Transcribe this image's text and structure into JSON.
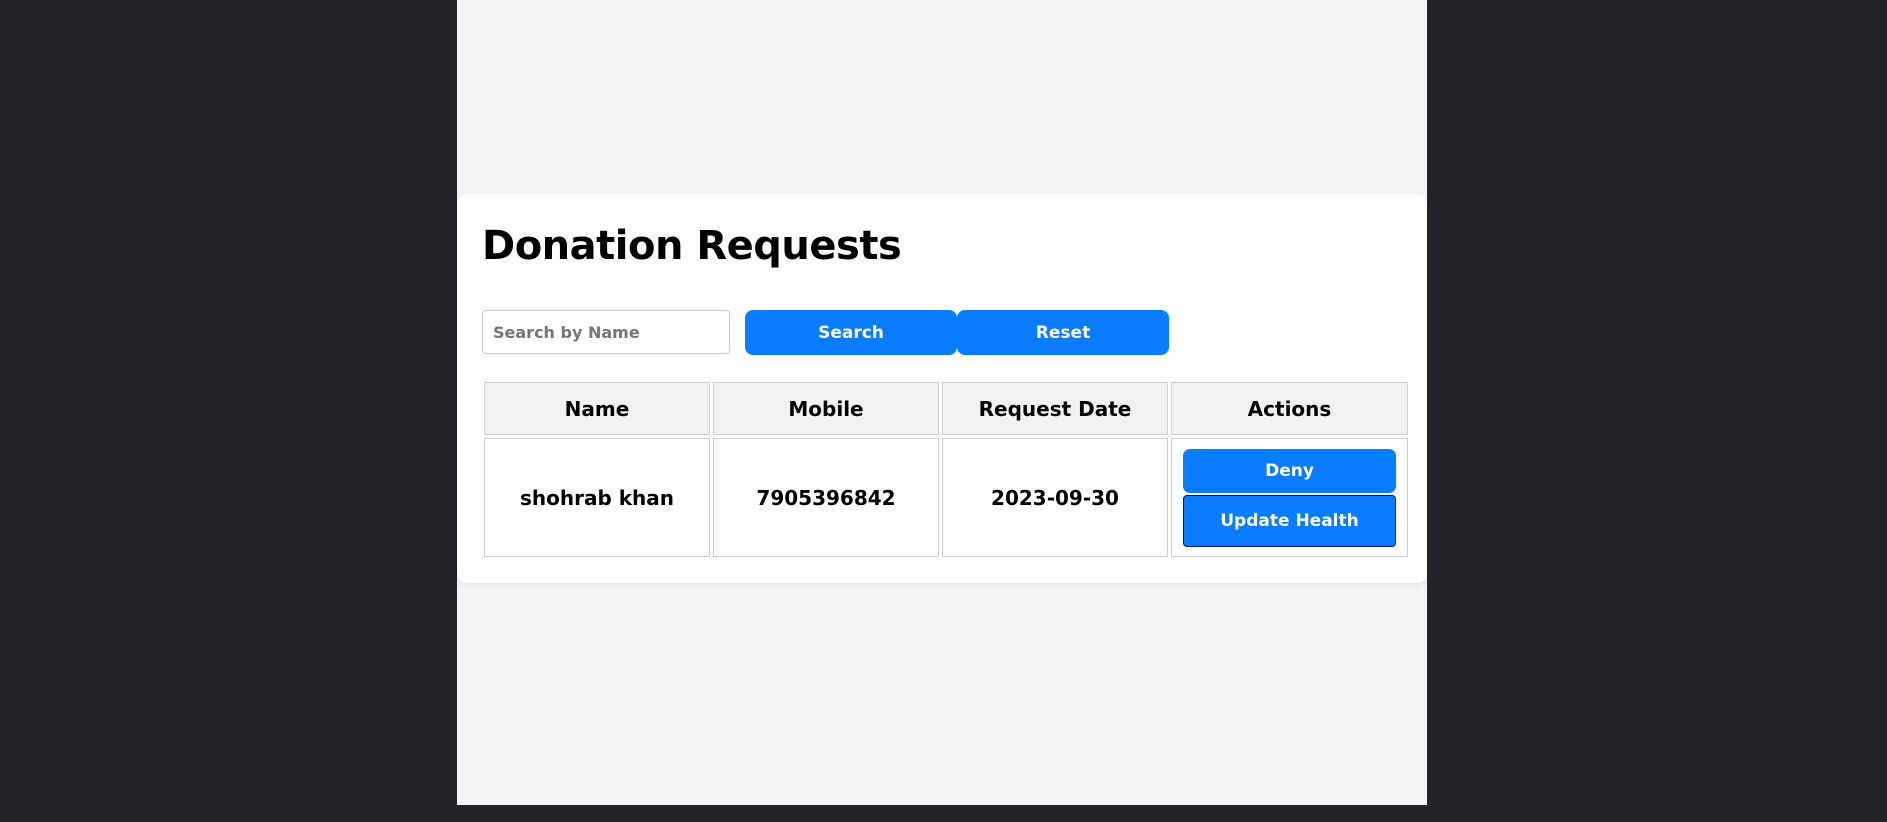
{
  "page": {
    "title": "Donation Requests"
  },
  "search": {
    "placeholder": "Search by Name",
    "value": "",
    "search_label": "Search",
    "reset_label": "Reset"
  },
  "table": {
    "headers": [
      "Name",
      "Mobile",
      "Request Date",
      "Actions"
    ],
    "rows": [
      {
        "name": "shohrab khan",
        "mobile": "7905396842",
        "request_date": "2023-09-30",
        "actions": {
          "deny_label": "Deny",
          "update_label": "Update Health"
        }
      }
    ]
  },
  "colors": {
    "accent": "#0a7cff",
    "page_bg": "#f4f5f7",
    "outer_bg": "#232428"
  }
}
